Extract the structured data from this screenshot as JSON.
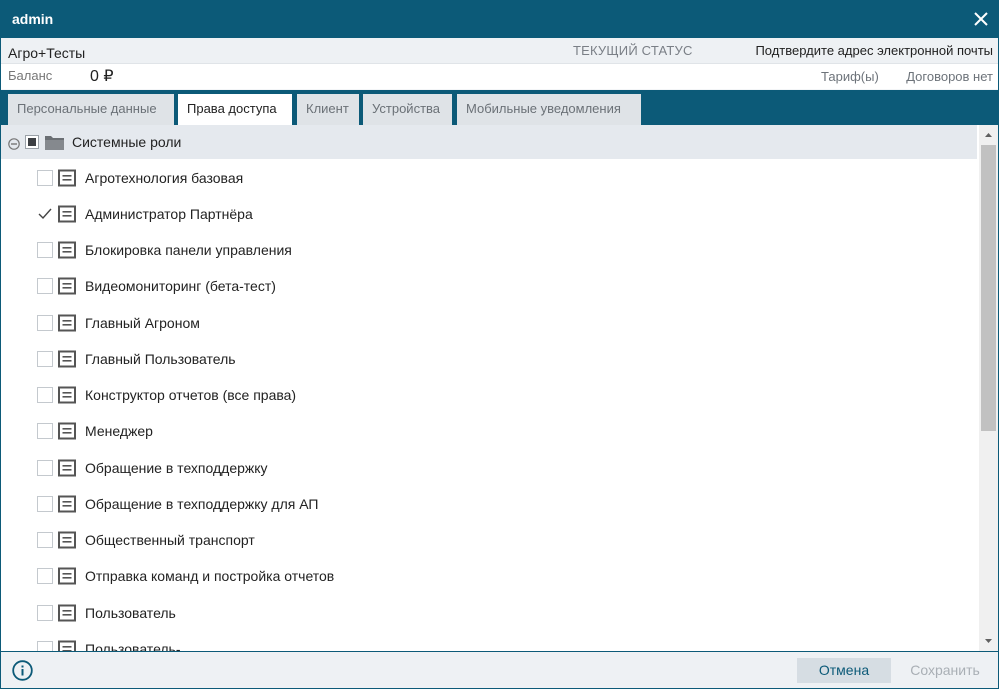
{
  "window": {
    "title": "admin"
  },
  "info": {
    "org_name": "Агро+Тесты",
    "status_label": "ТЕКУЩИЙ СТАТУС",
    "email_status": "Подтвердите адрес электронной почты",
    "balance_label": "Баланс",
    "balance_value": "0 ₽",
    "tariff_link": "Тариф(ы)",
    "contracts_text": "Договоров нет"
  },
  "tabs": [
    {
      "label": "Персональные данные",
      "active": false
    },
    {
      "label": "Права доступа",
      "active": true
    },
    {
      "label": "Клиент",
      "active": false
    },
    {
      "label": "Устройства",
      "active": false
    },
    {
      "label": "Мобильные уведомления",
      "active": false
    }
  ],
  "tree": {
    "root_label": "Системные роли",
    "items": [
      {
        "label": "Агротехнология базовая",
        "checked": false
      },
      {
        "label": "Администратор Партнёра",
        "checked": true
      },
      {
        "label": "Блокировка панели управления",
        "checked": false
      },
      {
        "label": "Видеомониторинг (бета-тест)",
        "checked": false
      },
      {
        "label": "Главный Агроном",
        "checked": false
      },
      {
        "label": "Главный Пользователь",
        "checked": false
      },
      {
        "label": "Конструктор отчетов (все права)",
        "checked": false
      },
      {
        "label": "Менеджер",
        "checked": false
      },
      {
        "label": "Обращение в техподдержку",
        "checked": false
      },
      {
        "label": "Обращение в техподдержку для АП",
        "checked": false
      },
      {
        "label": "Общественный транспорт",
        "checked": false
      },
      {
        "label": "Отправка команд и постройка отчетов",
        "checked": false
      },
      {
        "label": "Пользователь",
        "checked": false
      },
      {
        "label": "Пользователь-",
        "checked": false
      }
    ]
  },
  "footer": {
    "cancel_label": "Отмена",
    "save_label": "Сохранить"
  },
  "colors": {
    "header_bg": "#0c5a78",
    "tab_inactive_bg": "#dfe3e7",
    "root_row_bg": "#e5e9ee"
  },
  "icons": {
    "close": "close-icon",
    "collapse": "minus-circle-icon",
    "folder": "folder-icon",
    "role": "list-card-icon",
    "info": "info-icon"
  }
}
